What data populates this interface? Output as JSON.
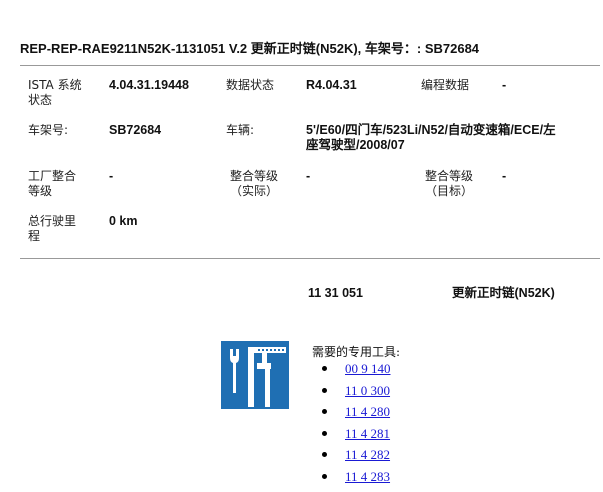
{
  "title": "REP-REP-RAE9211N52K-1131051   V.2   更新正时链(N52K), 车架号：: SB72684",
  "info": {
    "ista_label": [
      "ISTA 系统",
      "状态"
    ],
    "ista_value": "4.04.31.19448",
    "data_status_label": "数据状态",
    "data_status_value": "R4.04.31",
    "programming_label": "编程数据",
    "programming_value": "-",
    "vin_label": "车架号:",
    "vin_value": "SB72684",
    "vehicle_label": "车辆:",
    "vehicle_value": [
      "5'/E60/四门车/523Li/N52/自动变速箱/ECE/左",
      "座驾驶型/2008/07"
    ],
    "factory_label": [
      "工厂整合",
      "等级"
    ],
    "factory_value": "-",
    "integration_actual_label": [
      "整合等级",
      "（实际）"
    ],
    "integration_actual_value": "-",
    "integration_target_label": [
      "整合等级",
      "（目标）"
    ],
    "integration_target_value": "-",
    "mileage_label": [
      "总行驶里",
      "程"
    ],
    "mileage_value": "0 km"
  },
  "operation": {
    "number": "11 31 051",
    "name": "更新正时链(N52K)"
  },
  "special_tools": {
    "icon": "special-tools-icon",
    "heading": "需要的专用工具:",
    "items": [
      "00 9 140",
      "11 0 300",
      "11 4 280",
      "11 4 281",
      "11 4 282",
      "11 4 283"
    ]
  },
  "colors": {
    "icon_background": "#1f6fb3",
    "link": "#1a1ad4"
  }
}
